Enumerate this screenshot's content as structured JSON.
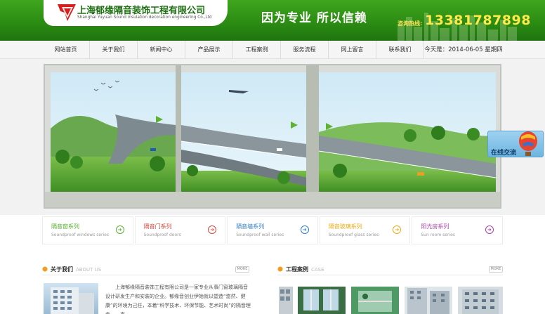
{
  "header": {
    "company_cn": "上海郁缘隔音装饰工程有限公司",
    "company_en": "Shanghai Yuyuan Sound insulation decoration engineering Co.,Ltd",
    "slogan": "因为专业  所以信赖",
    "hotline_label": "咨询热线:",
    "hotline_number": "13381787898"
  },
  "nav": {
    "items": [
      "网站首页",
      "关于我们",
      "新闻中心",
      "产品展示",
      "工程案例",
      "服务流程",
      "网上留言",
      "联系我们"
    ],
    "date_text": "今天是：2014-06-05 星期四"
  },
  "chat": {
    "label": "在线交流"
  },
  "products": [
    {
      "cn": "隔音窗系列",
      "en": "Soundproof windows series",
      "color": "#57b22f"
    },
    {
      "cn": "隔音门系列",
      "en": "Soundproof doors",
      "color": "#d9463b"
    },
    {
      "cn": "隔音墙系列",
      "en": "Soundproof wall series",
      "color": "#2e7fd1"
    },
    {
      "cn": "隔音玻璃系列",
      "en": "Soundproof glass series",
      "color": "#f0a915"
    },
    {
      "cn": "阳光房系列",
      "en": "Sun room series",
      "color": "#b03fae"
    }
  ],
  "about": {
    "title": "关于我们",
    "title_en": "ABOUT US",
    "more": "MORE",
    "text": "上海郁缘隔音装饰工程有限公司是一家专业从事门窗玻璃隔音设计研发生产和安装的企业。郁缘音创业伊始就以塑造“悠然、健康”的环境为己任，本着“科学技术、环保节能、艺术时尚”的隔音理念，一直"
  },
  "cases": {
    "title": "工程案例",
    "title_en": "CASE",
    "more": "MORE"
  },
  "colors": {
    "brand_green": "#2a8a12",
    "accent_yellow": "#ffe84a"
  }
}
